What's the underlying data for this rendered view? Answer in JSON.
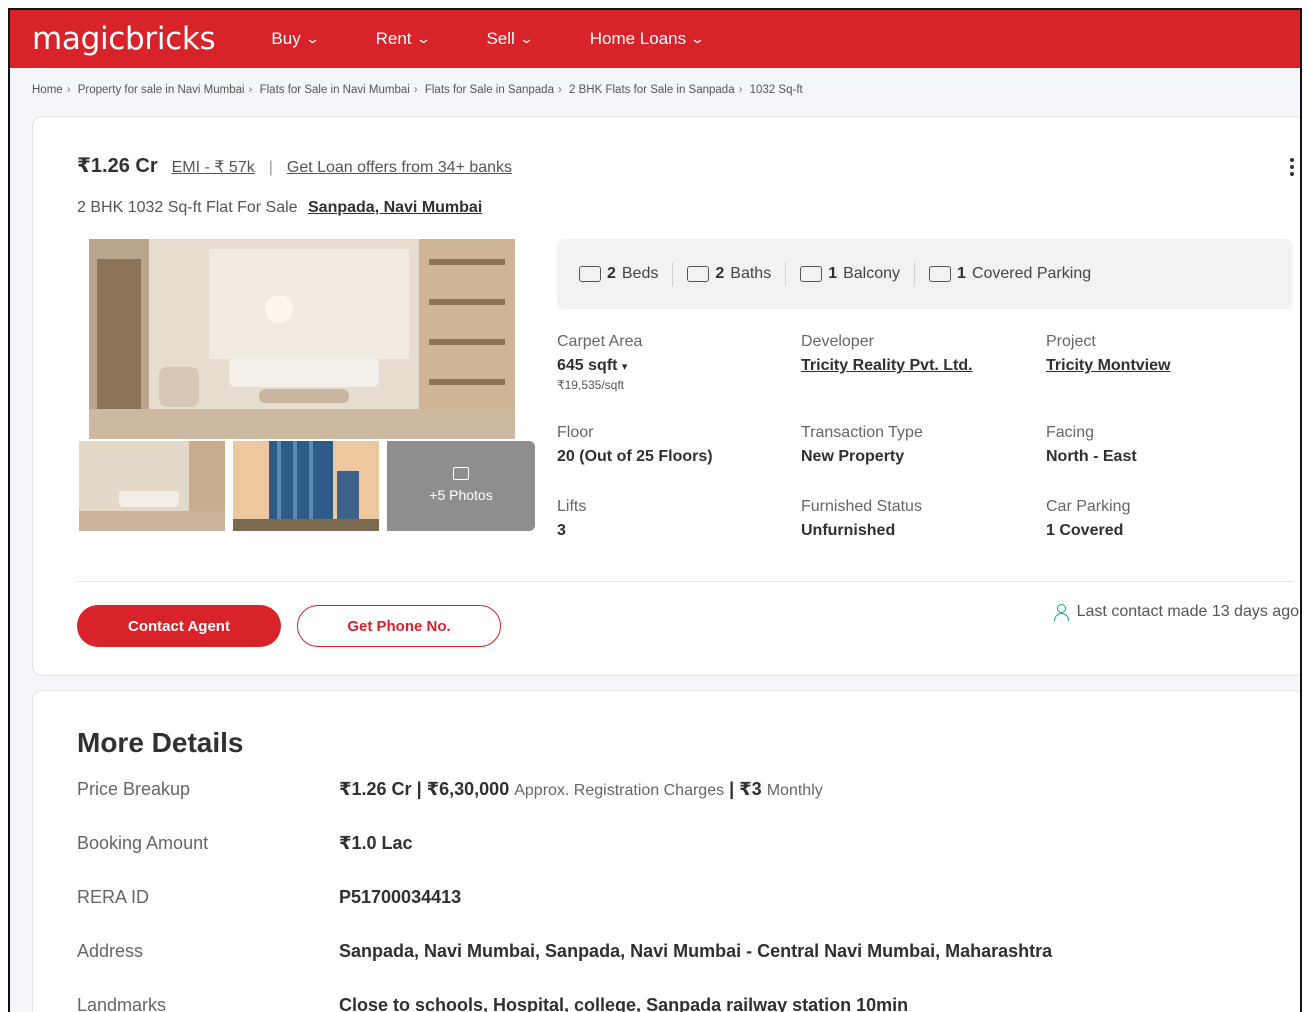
{
  "header": {
    "logo": "magicbricks",
    "nav": [
      "Buy",
      "Rent",
      "Sell",
      "Home Loans"
    ],
    "accent": "#d8232a"
  },
  "breadcrumb": [
    "Home",
    "Property for sale in Navi Mumbai",
    "Flats for Sale in Navi Mumbai",
    "Flats for Sale in Sanpada",
    "2 BHK Flats for Sale in Sanpada",
    "1032 Sq-ft"
  ],
  "listing": {
    "price": "₹1.26 Cr",
    "emi": "EMI - ₹ 57k",
    "loan": "Get Loan offers from 34+ banks",
    "title": "2 BHK 1032 Sq-ft Flat For Sale",
    "location": "Sanpada, Navi Mumbai",
    "photos_label": "+5 Photos",
    "amenities": [
      {
        "count": "2",
        "label": "Beds",
        "icon": "bed-icon"
      },
      {
        "count": "2",
        "label": "Baths",
        "icon": "bath-icon"
      },
      {
        "count": "1",
        "label": "Balcony",
        "icon": "balcony-icon"
      },
      {
        "count": "1",
        "label": "Covered Parking",
        "icon": "car-icon"
      }
    ],
    "specs": {
      "carpet_area": {
        "label": "Carpet Area",
        "value": "645 sqft",
        "sub": "₹19,535/sqft"
      },
      "developer": {
        "label": "Developer",
        "value": "Tricity Reality Pvt. Ltd."
      },
      "project": {
        "label": "Project",
        "value": "Tricity Montview"
      },
      "floor": {
        "label": "Floor",
        "value": "20 (Out of 25 Floors)"
      },
      "transaction": {
        "label": "Transaction Type",
        "value": "New Property"
      },
      "facing": {
        "label": "Facing",
        "value": "North - East"
      },
      "lifts": {
        "label": "Lifts",
        "value": "3"
      },
      "furnished": {
        "label": "Furnished Status",
        "value": "Unfurnished"
      },
      "car_parking": {
        "label": "Car Parking",
        "value": "1 Covered"
      }
    },
    "contact_button": "Contact Agent",
    "phone_button": "Get Phone No.",
    "last_contact": "Last contact made 13 days ago"
  },
  "more_details": {
    "title": "More Details",
    "rows": {
      "price_breakup": {
        "label": "Price Breakup",
        "price": "₹1.26 Cr",
        "registration": "₹6,30,000",
        "registration_label": "Approx. Registration Charges",
        "monthly": "₹3",
        "monthly_label": "Monthly"
      },
      "booking": {
        "label": "Booking Amount",
        "value": "₹1.0 Lac"
      },
      "rera": {
        "label": "RERA ID",
        "value": "P51700034413"
      },
      "address": {
        "label": "Address",
        "value": "Sanpada, Navi Mumbai, Sanpada, Navi Mumbai - Central Navi Mumbai, Maharashtra"
      },
      "landmarks": {
        "label": "Landmarks",
        "value": "Close to schools, Hospital, college, Sanpada railway station 10min"
      }
    }
  }
}
